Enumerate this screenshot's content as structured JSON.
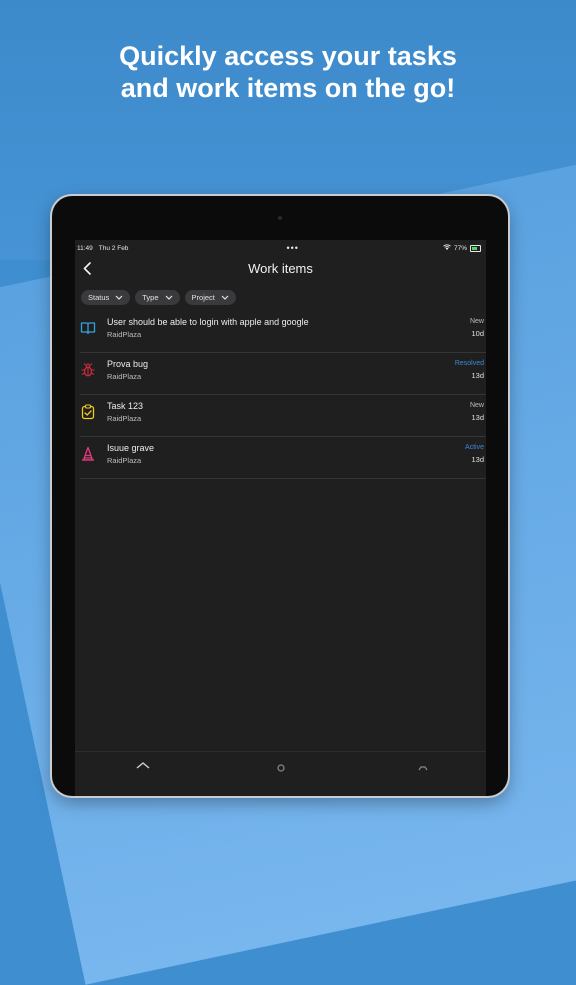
{
  "headline": {
    "line1": "Quickly access your tasks",
    "line2": "and work items on the go!"
  },
  "status_bar": {
    "time": "11:49",
    "date": "Thu 2 Feb",
    "dots": "•••",
    "battery": "77%"
  },
  "nav": {
    "title": "Work items"
  },
  "filters": [
    {
      "label": "Status"
    },
    {
      "label": "Type"
    },
    {
      "label": "Project"
    }
  ],
  "work_items": [
    {
      "title": "User should be able to login with apple and google",
      "project": "RaidPlaza",
      "state": "New",
      "age": "10d",
      "icon": "book-icon",
      "color": "#33a3dc"
    },
    {
      "title": "Prova bug",
      "project": "RaidPlaza",
      "state": "Resolved",
      "age": "13d",
      "icon": "bug-icon",
      "color": "#cc293d"
    },
    {
      "title": "Task 123",
      "project": "RaidPlaza",
      "state": "New",
      "age": "13d",
      "icon": "task-icon",
      "color": "#f2cb1d"
    },
    {
      "title": "Isuue grave",
      "project": "RaidPlaza",
      "state": "Active",
      "age": "13d",
      "icon": "issue-icon",
      "color": "#e33b7c"
    }
  ],
  "colors": {
    "background": "#3f8fd0",
    "screen": "#1f1f20",
    "chip": "#3a3a3c",
    "link_state": "#3a8ad8"
  }
}
